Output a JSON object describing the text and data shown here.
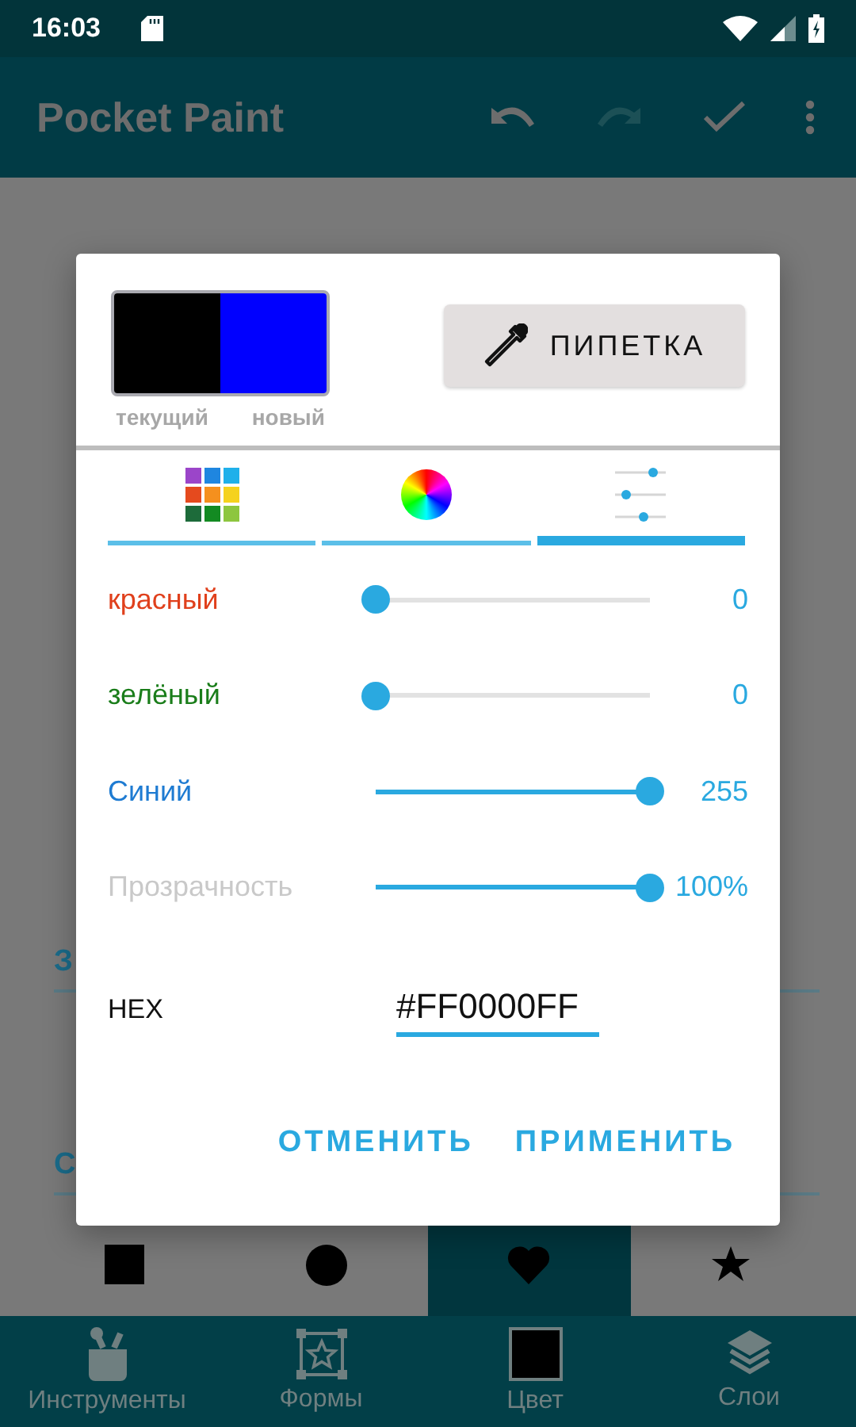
{
  "status_bar": {
    "time": "16:03"
  },
  "app_bar": {
    "title": "Pocket Paint"
  },
  "background_fields": [
    {
      "label": "З"
    },
    {
      "label": "С"
    }
  ],
  "shapes": [
    {
      "kind": "square",
      "selected": false
    },
    {
      "kind": "circle",
      "selected": false
    },
    {
      "kind": "heart",
      "selected": true
    },
    {
      "kind": "star",
      "selected": false
    }
  ],
  "bottom_nav": [
    {
      "kind": "tools",
      "label": "Инструменты"
    },
    {
      "kind": "shapes",
      "label": "Формы"
    },
    {
      "kind": "color",
      "label": "Цвет"
    },
    {
      "kind": "layers",
      "label": "Слои"
    }
  ],
  "dialog": {
    "swatches": [
      {
        "label": "текущий",
        "color": "#000000"
      },
      {
        "label": "новый",
        "color": "#0000ff"
      }
    ],
    "pipette_button": "ПИПЕТКА",
    "tabs": [
      {
        "kind": "presets",
        "selected": false
      },
      {
        "kind": "wheel",
        "selected": false
      },
      {
        "kind": "sliders",
        "selected": true
      }
    ],
    "sliders": [
      {
        "label": "красный",
        "color": "#e0401c",
        "level": 0,
        "reading": "0"
      },
      {
        "label": "зелёный",
        "color": "#1a7d1a",
        "level": 0,
        "reading": "0"
      },
      {
        "label": "Синий",
        "color": "#1e7bd2",
        "level": 1,
        "reading": "255"
      },
      {
        "label": "Прозрачность",
        "color": "#c9c9c9",
        "level": 1,
        "reading": "100%"
      }
    ],
    "hex": {
      "label": "HEX",
      "value": "#FF0000FF"
    },
    "buttons": [
      "ОТМЕНИТЬ",
      "ПРИМЕНИТЬ"
    ]
  }
}
